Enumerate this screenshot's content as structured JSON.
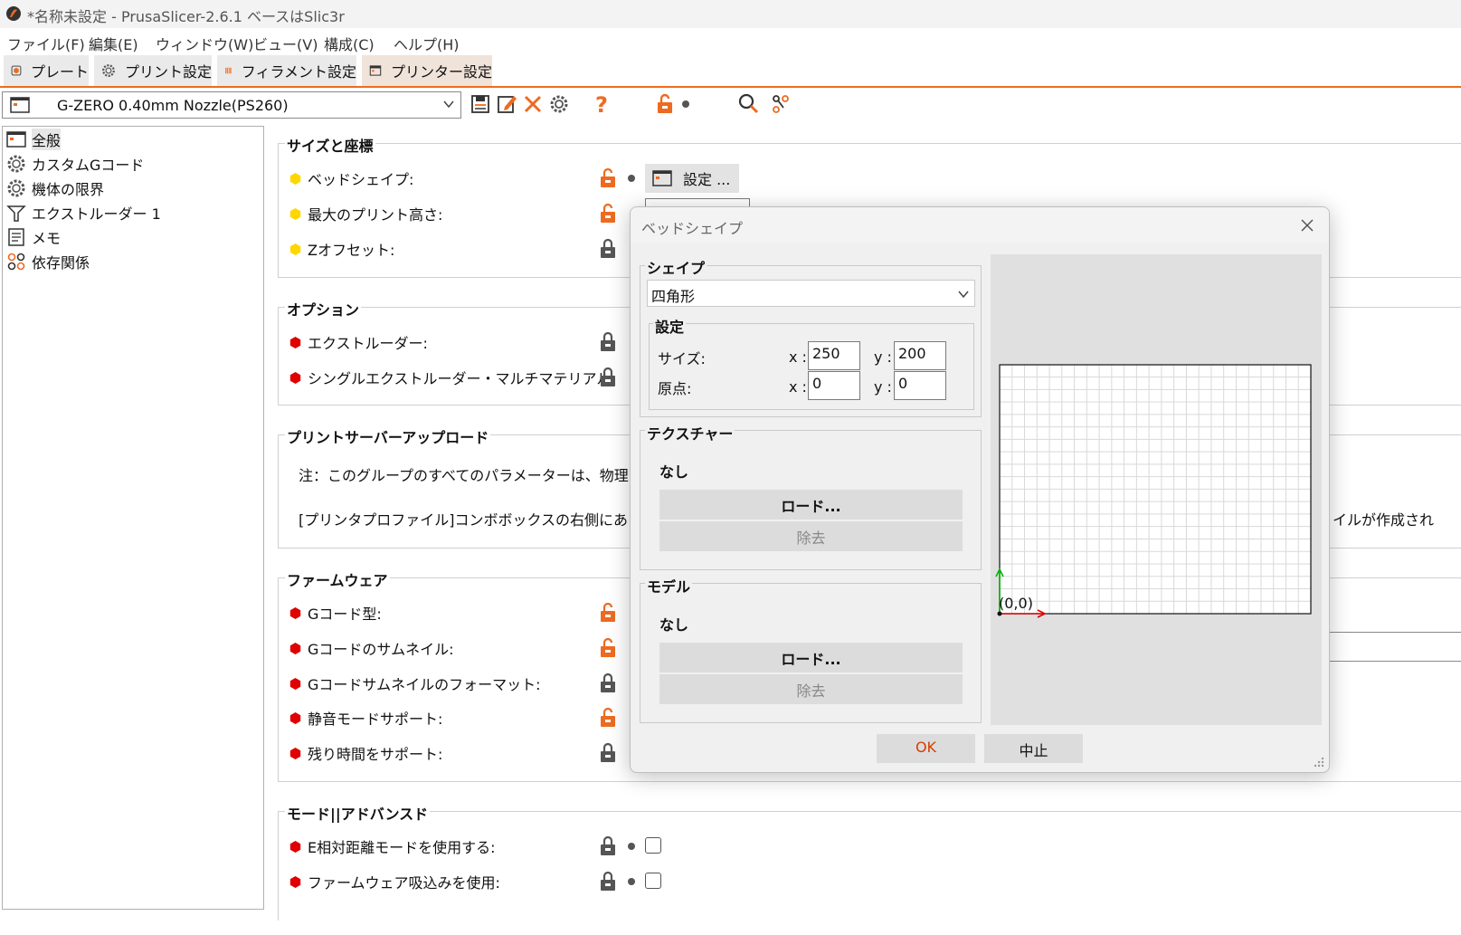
{
  "window": {
    "title": "*名称未設定 - PrusaSlicer-2.6.1 ベースはSlic3r"
  },
  "menu": [
    "ファイル(F)",
    "編集(E)",
    "ウィンドウ(W)",
    "ビュー(V)",
    "構成(C)",
    "ヘルプ(H)"
  ],
  "tabs": [
    {
      "label": "プレート",
      "icon": "plater-icon"
    },
    {
      "label": "プリント設定",
      "icon": "cog-icon"
    },
    {
      "label": "フィラメント設定",
      "icon": "spool-icon"
    },
    {
      "label": "プリンター設定",
      "icon": "printer-icon",
      "active": true
    }
  ],
  "preset": {
    "value": "G-ZERO 0.40mm Nozzle(PS260)"
  },
  "tree": [
    "全般",
    "カスタムGコード",
    "機体の限界",
    "エクストルーダー 1",
    "メモ",
    "依存関係"
  ],
  "groups": {
    "size": {
      "title": "サイズと座標",
      "rows": [
        "ベッドシェイプ:",
        "最大のプリント高さ:",
        "Zオフセット:"
      ],
      "bed_shape_button": "設定 ..."
    },
    "options": {
      "title": "オプション",
      "rows": [
        "エクストルーダー:",
        "シングルエクストルーダー・マルチマテリアル:"
      ]
    },
    "upload": {
      "title": "プリントサーバーアップロード",
      "note1": "注：このグループのすべてのパラメーターは、物理プリンタ",
      "note2": "[プリンタプロファイル]コンボボックスの右側にある[歯車]",
      "note2_tail": "イルが作成され"
    },
    "firmware": {
      "title": "ファームウェア",
      "rows": [
        "Gコード型:",
        "Gコードのサムネイル:",
        "Gコードサムネイルのフォーマット:",
        "静音モードサポート:",
        "残り時間をサポート:"
      ]
    },
    "advanced": {
      "title": "モード||アドバンスド",
      "rows": [
        "E相対距離モードを使用する:",
        "ファームウェア吸込みを使用:"
      ]
    }
  },
  "dialog": {
    "title": "ベッドシェイプ",
    "shape_title": "シェイプ",
    "shape_value": "四角形",
    "settings_title": "設定",
    "size_label": "サイズ:",
    "origin_label": "原点:",
    "x_label": "x :",
    "y_label": "y :",
    "size_x": "250",
    "size_y": "200",
    "origin_x": "0",
    "origin_y": "0",
    "texture_title": "テクスチャー",
    "texture_value": "なし",
    "model_title": "モデル",
    "model_value": "なし",
    "load_label": "ロード...",
    "remove_label": "除去",
    "origin_marker": "(0,0)",
    "ok_label": "OK",
    "cancel_label": "中止"
  },
  "colors": {
    "accent": "#ed6b21",
    "system_value": "#ffd700",
    "modified_value": "#e00000"
  }
}
